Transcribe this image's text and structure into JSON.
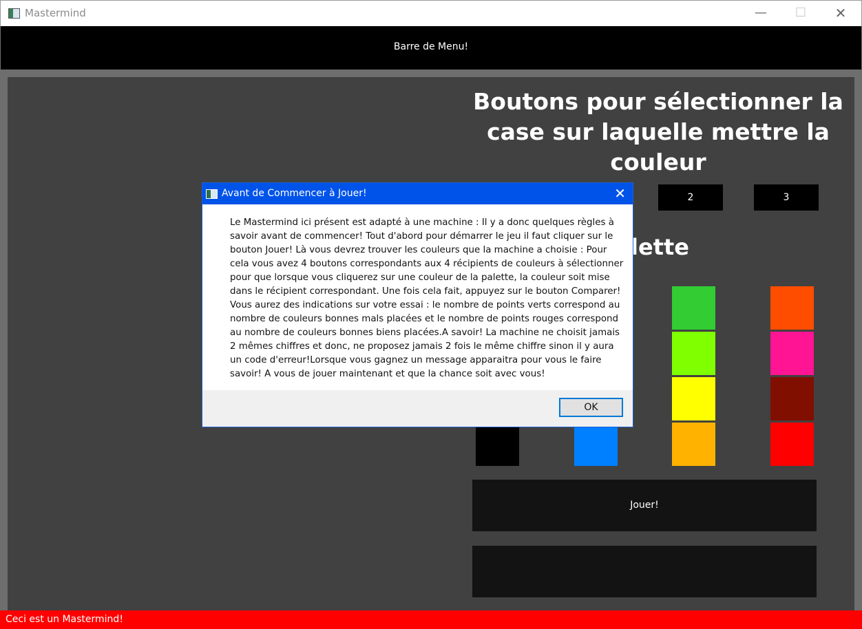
{
  "window": {
    "title": "Mastermind",
    "minimize": "—",
    "maximize": "☐",
    "close": "✕"
  },
  "menubar": {
    "label": "Barre de Menu!"
  },
  "main": {
    "heading": "Boutons pour sélectionner la case sur laquelle mettre la couleur",
    "slot_buttons": [
      "2",
      "3"
    ],
    "palette_heading_partial": "lette",
    "palette_colors": {
      "col1": [
        "#000000"
      ],
      "col2": [
        "#0080ff"
      ],
      "col3": [
        "#33cc33",
        "#80ff00",
        "#ffff00",
        "#ffb300"
      ],
      "col4": [
        "#ff4d00",
        "#ff1493",
        "#800f00",
        "#ff0000"
      ]
    },
    "play_button": "Jouer!",
    "second_button": ""
  },
  "statusbar": {
    "text": "Ceci est un Mastermind!"
  },
  "dialog": {
    "title": "Avant de Commencer à Jouer!",
    "message": "Le Mastermind ici présent est adapté à une machine : Il y a donc quelques règles à savoir avant de commencer! Tout d'abord pour démarrer le jeu il faut cliquer sur le bouton Jouer! Là vous devrez trouver les couleurs que la machine a choisie : Pour cela vous avez 4 boutons correspondants aux 4 récipients de couleurs à sélectionner pour que lorsque vous cliquerez sur une couleur de la palette, la couleur soit mise dans le récipient correspondant. Une fois cela fait, appuyez sur le bouton Comparer! Vous aurez des indications sur votre essai : le nombre de points verts correspond au nombre de couleurs bonnes mals placées et le nombre de points rouges correspond au nombre de couleurs bonnes biens placées.A savoir! La machine ne choisit jamais 2 mêmes chiffres et donc, ne proposez jamais 2 fois le même chiffre sinon il y aura un code d'erreur!Lorsque vous gagnez un message apparaitra pour vous le faire savoir! A vous de jouer maintenant et que la chance soit avec vous!",
    "close": "✕",
    "ok_label": "OK"
  }
}
